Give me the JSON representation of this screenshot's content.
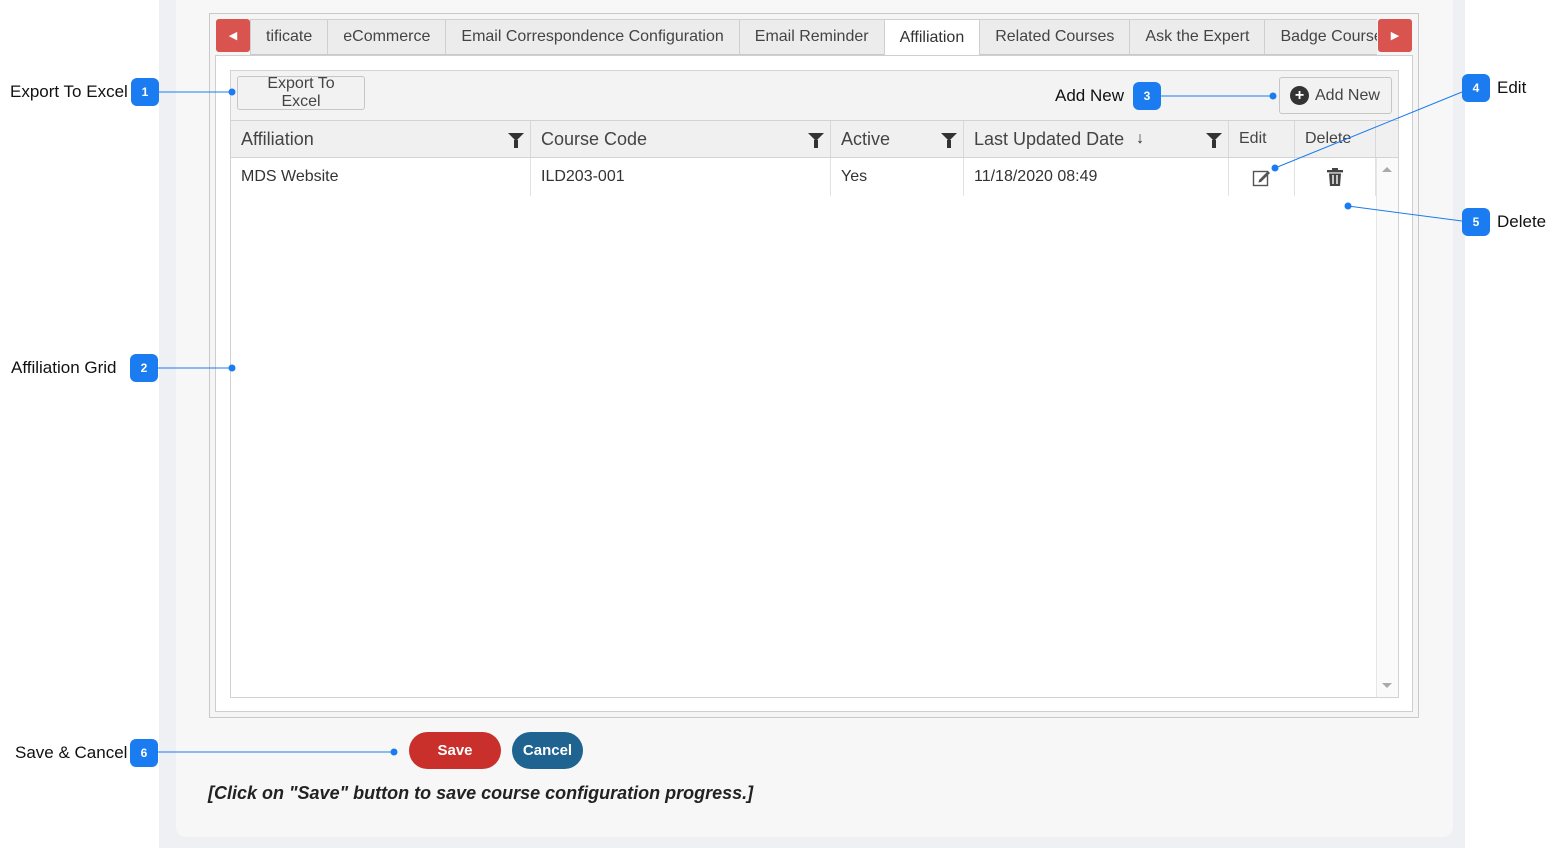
{
  "tabs": {
    "items": [
      {
        "label": "tificate"
      },
      {
        "label": "eCommerce"
      },
      {
        "label": "Email Correspondence Configuration"
      },
      {
        "label": "Email Reminder"
      },
      {
        "label": "Affiliation"
      },
      {
        "label": "Related Courses"
      },
      {
        "label": "Ask the Expert"
      },
      {
        "label": "Badge Course Ma"
      }
    ],
    "active": "Affiliation",
    "prev_icon": "caret-left-icon",
    "next_icon": "caret-right-icon"
  },
  "toolbar": {
    "export_label": "Export To Excel",
    "add_label": "Add New",
    "add_icon": "plus-circle-icon"
  },
  "grid": {
    "columns": [
      {
        "label": "Affiliation",
        "filter": true
      },
      {
        "label": "Course Code",
        "filter": true
      },
      {
        "label": "Active",
        "filter": true
      },
      {
        "label": "Last Updated Date",
        "filter": true,
        "sort": "desc"
      },
      {
        "label": "Edit"
      },
      {
        "label": "Delete"
      }
    ],
    "rows": [
      {
        "affiliation": "MDS Website",
        "course_code": "ILD203-001",
        "active": "Yes",
        "last_updated": "11/18/2020 08:49"
      }
    ]
  },
  "actions": {
    "save_label": "Save",
    "cancel_label": "Cancel"
  },
  "note": "[Click on \"Save\" button to save course configuration progress.]",
  "annotations": [
    {
      "num": "1",
      "label": "Export To Excel"
    },
    {
      "num": "2",
      "label": "Affiliation Grid"
    },
    {
      "num": "3",
      "label": "Add New"
    },
    {
      "num": "4",
      "label": "Edit"
    },
    {
      "num": "5",
      "label": "Delete"
    },
    {
      "num": "6",
      "label": "Save & Cancel"
    }
  ],
  "colors": {
    "accent_red": "#d9534f",
    "save": "#c9302c",
    "cancel": "#1f6391",
    "badge": "#1a7cf0"
  }
}
